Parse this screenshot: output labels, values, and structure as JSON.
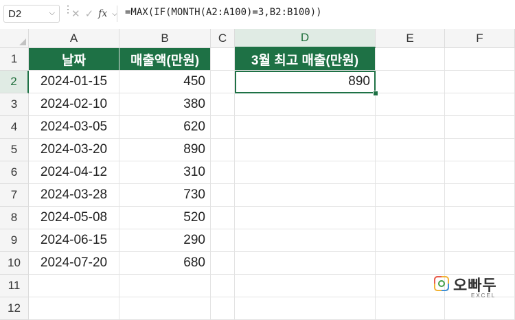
{
  "name_box": {
    "value": "D2"
  },
  "formula_bar": {
    "cancel_glyph": "✕",
    "enter_glyph": "✓",
    "fx_label": "fx",
    "formula": "=MAX(IF(MONTH(A2:A100)=3,B2:B100))"
  },
  "columns": [
    "A",
    "B",
    "C",
    "D",
    "E",
    "F"
  ],
  "rows": [
    "1",
    "2",
    "3",
    "4",
    "5",
    "6",
    "7",
    "8",
    "9",
    "10",
    "11",
    "12"
  ],
  "headers": {
    "date": "날짜",
    "sales": "매출액(만원)",
    "result": "3월 최고 매출(만원)"
  },
  "table": [
    {
      "date": "2024-01-15",
      "sales": "450"
    },
    {
      "date": "2024-02-10",
      "sales": "380"
    },
    {
      "date": "2024-03-05",
      "sales": "620"
    },
    {
      "date": "2024-03-20",
      "sales": "890"
    },
    {
      "date": "2024-04-12",
      "sales": "310"
    },
    {
      "date": "2024-03-28",
      "sales": "730"
    },
    {
      "date": "2024-05-08",
      "sales": "520"
    },
    {
      "date": "2024-06-15",
      "sales": "290"
    },
    {
      "date": "2024-07-20",
      "sales": "680"
    }
  ],
  "result_value": "890",
  "selection": {
    "active_cell": "D2",
    "active_column": "D",
    "active_row": "2"
  },
  "colors": {
    "header_green": "#1e7145",
    "selection": "#1e7145"
  },
  "logo": {
    "name": "오빠두",
    "sub": "EXCEL"
  }
}
